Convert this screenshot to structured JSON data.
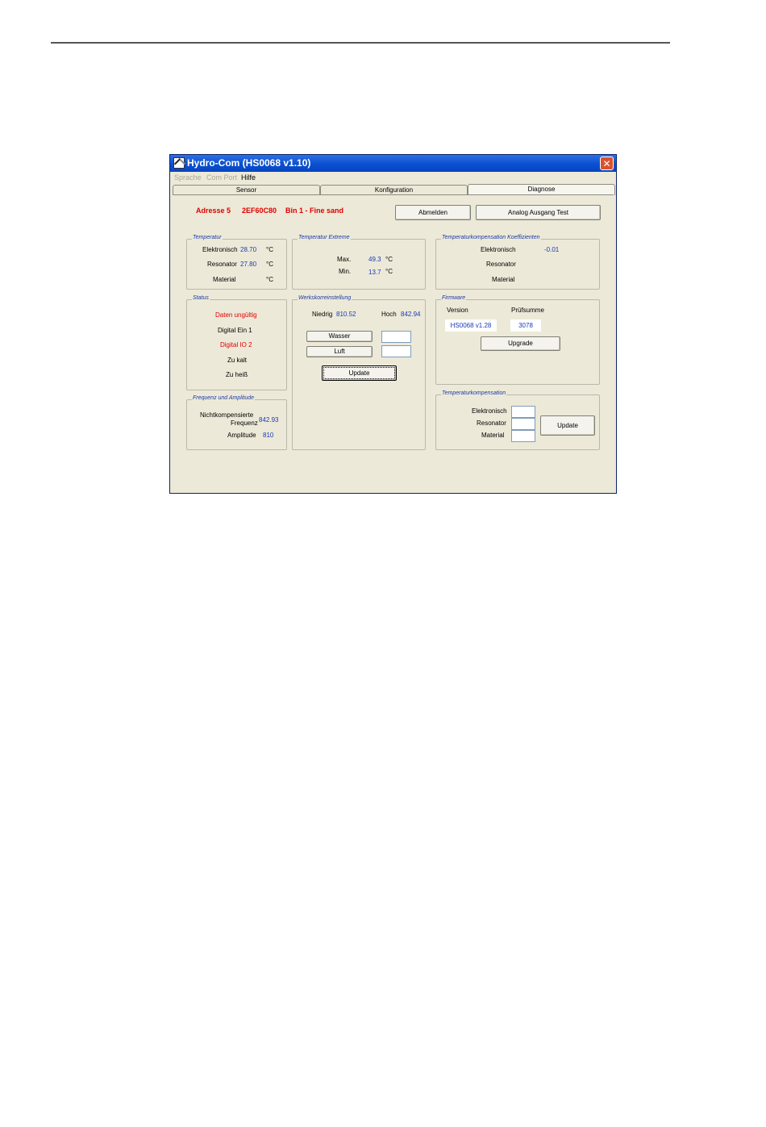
{
  "window": {
    "title": "Hydro-Com (HS0068 v1.10)",
    "close_glyph": "✕"
  },
  "menu": {
    "items": [
      "Sprache",
      "Com Port",
      "Hilfe"
    ]
  },
  "tabs": [
    "Sensor",
    "Konfiguration",
    "Diagnose"
  ],
  "header": {
    "address": "Adresse 5",
    "id": "2EF60C80",
    "bin": "Bin 1 - Fine sand"
  },
  "buttons": {
    "abmelden": "Abmelden",
    "analog_test": "Analog Ausgang Test"
  },
  "temperatur": {
    "title": "Temperatur",
    "rows": [
      {
        "label": "Elektronisch",
        "value": "28.70",
        "unit": "°C"
      },
      {
        "label": "Resonator",
        "value": "27.80",
        "unit": "°C"
      },
      {
        "label": "Material",
        "value": "",
        "unit": "°C"
      }
    ]
  },
  "extreme": {
    "title": "Temperatur Extreme",
    "max_label": "Max.",
    "max_value": "49.3",
    "max_unit": "°C",
    "min_label": "Min.",
    "min_value": "13.7",
    "min_unit": "°C"
  },
  "koeff": {
    "title": "Temperaturkompensation Koeffizienten",
    "elektronisch_label": "Elektronisch",
    "elektronisch_value": "-0.01",
    "resonator_label": "Resonator",
    "material_label": "Material"
  },
  "status": {
    "title": "Status",
    "items": [
      "Daten ungültig",
      "Digital Ein 1",
      "Digital IO 2",
      "Zu kalt",
      "Zu heiß"
    ]
  },
  "werks": {
    "title": "Werkskorreinstellung",
    "niedrig_label": "Niedrig",
    "niedrig_value": "810.52",
    "hoch_label": "Hoch",
    "hoch_value": "842.94",
    "wasser_label": "Wasser",
    "luft_label": "Luft",
    "update_label": "Update"
  },
  "firmware": {
    "title": "Firmware",
    "version_label": "Version",
    "pruef_label": "Prüfsumme",
    "version_value": "HS0068 v1.28",
    "pruef_value": "3078",
    "upgrade_label": "Upgrade"
  },
  "frequenz": {
    "title": "Frequenz und Amplitude",
    "nk_label_1": "Nichtkompensierte",
    "nk_label_2": "Frequenz",
    "nk_value": "842.93",
    "amp_label": "Amplitude",
    "amp_value": "810"
  },
  "tempkomp": {
    "title": "Temperaturkompensation",
    "elektronisch_label": "Elektronisch",
    "resonator_label": "Resonator",
    "material_label": "Material",
    "update_label": "Update"
  }
}
